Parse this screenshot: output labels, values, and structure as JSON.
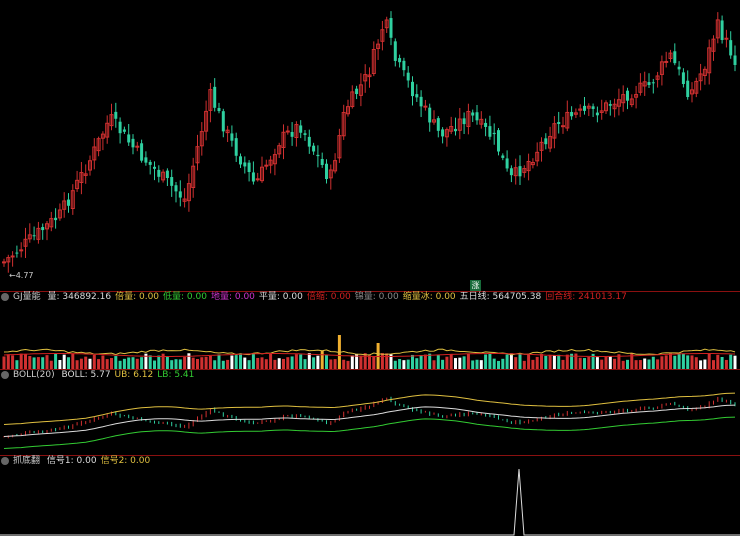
{
  "price_pane": {
    "low_label": "4.77",
    "badge": "涨"
  },
  "gj_pane": {
    "name": "GJ量能",
    "fields": [
      {
        "label": "量:",
        "value": "346892.16",
        "color": "#dcdcdc"
      },
      {
        "label": "倍量:",
        "value": "0.00",
        "color": "#e0c040"
      },
      {
        "label": "低量:",
        "value": "0.00",
        "color": "#33cc33"
      },
      {
        "label": "地量:",
        "value": "0.00",
        "color": "#cc33cc"
      },
      {
        "label": "平量:",
        "value": "0.00",
        "color": "#dcdcdc"
      },
      {
        "label": "倍缩:",
        "value": "0.00",
        "color": "#d02020"
      },
      {
        "label": "锦量:",
        "value": "0.00",
        "color": "#888888"
      },
      {
        "label": "缩量冰:",
        "value": "0.00",
        "color": "#e0c040"
      },
      {
        "label": "五日线:",
        "value": "564705.38",
        "color": "#dcdcdc"
      },
      {
        "label": "回合线:",
        "value": "241013.17",
        "color": "#d02020"
      }
    ]
  },
  "boll_pane": {
    "name": "BOLL(20)",
    "fields": [
      {
        "label": "BOLL:",
        "value": "5.77",
        "color": "#dcdcdc"
      },
      {
        "label": "UB:",
        "value": "6.12",
        "color": "#e0c040"
      },
      {
        "label": "LB:",
        "value": "5.41",
        "color": "#33cc33"
      }
    ]
  },
  "signal_pane": {
    "name": "抓底翻",
    "fields": [
      {
        "label": "信号1:",
        "value": "0.00",
        "color": "#dcdcdc"
      },
      {
        "label": "信号2:",
        "value": "0.00",
        "color": "#e0c040"
      }
    ]
  },
  "colors": {
    "up": "#d03030",
    "down": "#2fd0a0",
    "grid": "#8a1010"
  }
}
